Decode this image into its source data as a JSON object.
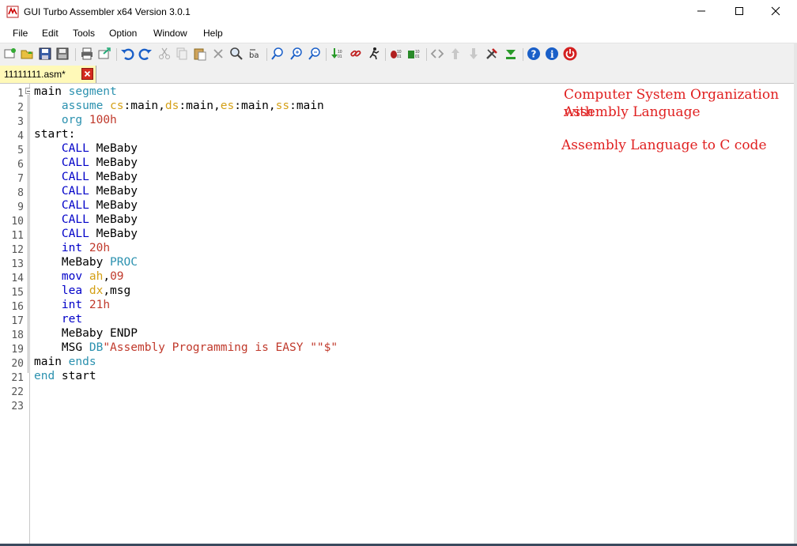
{
  "window": {
    "title": "GUI Turbo Assembler x64 Version 3.0.1",
    "controls": [
      "minimize-icon",
      "maximize-icon",
      "close-icon"
    ]
  },
  "menu": {
    "items": [
      "File",
      "Edit",
      "Tools",
      "Option",
      "Window",
      "Help"
    ]
  },
  "toolbar": {
    "icons": [
      "new-file-icon",
      "open-folder-icon",
      "save-icon",
      "save-all-icon",
      "print-icon",
      "export-icon",
      "undo-icon",
      "redo-icon",
      "cut-icon",
      "copy-icon",
      "paste-icon",
      "delete-icon",
      "find-icon",
      "replace-icon",
      "find-next-icon",
      "zoom-in-icon",
      "zoom-out-icon",
      "assemble-icon",
      "link-icon",
      "run-icon",
      "debug-icon",
      "breakpoint-icon",
      "code-view-icon",
      "move-up-icon",
      "move-down-icon",
      "tools-icon",
      "download-icon",
      "help-icon",
      "info-icon",
      "power-icon"
    ]
  },
  "tab": {
    "label": "11111111.asm*"
  },
  "editor": {
    "line_numbers": [
      "1",
      "2",
      "3",
      "4",
      "5",
      "6",
      "7",
      "8",
      "9",
      "10",
      "11",
      "12",
      "13",
      "14",
      "15",
      "16",
      "17",
      "18",
      "19",
      "20",
      "21",
      "22",
      "23"
    ],
    "lines": [
      [
        {
          "t": "main ",
          "c": "plain"
        },
        {
          "t": "segment",
          "c": "directive"
        }
      ],
      [
        {
          "t": "    ",
          "c": "plain"
        },
        {
          "t": "assume",
          "c": "directive"
        },
        {
          "t": " ",
          "c": "plain"
        },
        {
          "t": "cs",
          "c": "register"
        },
        {
          "t": ":main,",
          "c": "plain"
        },
        {
          "t": "ds",
          "c": "register"
        },
        {
          "t": ":main,",
          "c": "plain"
        },
        {
          "t": "es",
          "c": "register"
        },
        {
          "t": ":main,",
          "c": "plain"
        },
        {
          "t": "ss",
          "c": "register"
        },
        {
          "t": ":main",
          "c": "plain"
        }
      ],
      [
        {
          "t": "    ",
          "c": "plain"
        },
        {
          "t": "org",
          "c": "directive"
        },
        {
          "t": " ",
          "c": "plain"
        },
        {
          "t": "100h",
          "c": "number"
        }
      ],
      [
        {
          "t": "start:",
          "c": "plain"
        }
      ],
      [
        {
          "t": "    ",
          "c": "plain"
        },
        {
          "t": "CALL",
          "c": "instruction"
        },
        {
          "t": " MeBaby",
          "c": "plain"
        }
      ],
      [
        {
          "t": "    ",
          "c": "plain"
        },
        {
          "t": "CALL",
          "c": "instruction"
        },
        {
          "t": " MeBaby",
          "c": "plain"
        }
      ],
      [
        {
          "t": "    ",
          "c": "plain"
        },
        {
          "t": "CALL",
          "c": "instruction"
        },
        {
          "t": " MeBaby",
          "c": "plain"
        }
      ],
      [
        {
          "t": "    ",
          "c": "plain"
        },
        {
          "t": "CALL",
          "c": "instruction"
        },
        {
          "t": " MeBaby",
          "c": "plain"
        }
      ],
      [
        {
          "t": "    ",
          "c": "plain"
        },
        {
          "t": "CALL",
          "c": "instruction"
        },
        {
          "t": " MeBaby",
          "c": "plain"
        }
      ],
      [
        {
          "t": "    ",
          "c": "plain"
        },
        {
          "t": "CALL",
          "c": "instruction"
        },
        {
          "t": " MeBaby",
          "c": "plain"
        }
      ],
      [
        {
          "t": "    ",
          "c": "plain"
        },
        {
          "t": "CALL",
          "c": "instruction"
        },
        {
          "t": " MeBaby",
          "c": "plain"
        }
      ],
      [
        {
          "t": "    ",
          "c": "plain"
        },
        {
          "t": "int",
          "c": "instruction"
        },
        {
          "t": " ",
          "c": "plain"
        },
        {
          "t": "20h",
          "c": "number"
        }
      ],
      [
        {
          "t": "    MeBaby ",
          "c": "plain"
        },
        {
          "t": "PROC",
          "c": "directive"
        }
      ],
      [
        {
          "t": "    ",
          "c": "plain"
        },
        {
          "t": "mov",
          "c": "instruction"
        },
        {
          "t": " ",
          "c": "plain"
        },
        {
          "t": "ah",
          "c": "register"
        },
        {
          "t": ",",
          "c": "plain"
        },
        {
          "t": "09",
          "c": "number"
        }
      ],
      [
        {
          "t": "    ",
          "c": "plain"
        },
        {
          "t": "lea",
          "c": "instruction"
        },
        {
          "t": " ",
          "c": "plain"
        },
        {
          "t": "dx",
          "c": "register"
        },
        {
          "t": ",msg",
          "c": "plain"
        }
      ],
      [
        {
          "t": "    ",
          "c": "plain"
        },
        {
          "t": "int",
          "c": "instruction"
        },
        {
          "t": " ",
          "c": "plain"
        },
        {
          "t": "21h",
          "c": "number"
        }
      ],
      [
        {
          "t": "    ",
          "c": "plain"
        },
        {
          "t": "ret",
          "c": "instruction"
        }
      ],
      [
        {
          "t": "    MeBaby ENDP",
          "c": "plain"
        }
      ],
      [
        {
          "t": "    MSG ",
          "c": "plain"
        },
        {
          "t": "DB",
          "c": "directive"
        },
        {
          "t": "\"Assembly Programming is EASY \"\"$\"",
          "c": "string"
        }
      ],
      [
        {
          "t": "main ",
          "c": "plain"
        },
        {
          "t": "ends",
          "c": "directive"
        }
      ],
      [
        {
          "t": "end",
          "c": "directive"
        },
        {
          "t": " start",
          "c": "plain"
        }
      ],
      [],
      []
    ]
  },
  "syntax_colors": {
    "plain": "#000000",
    "directive": "#2b91af",
    "register": "#d4a017",
    "number": "#c0392b",
    "instruction": "#0000c8",
    "string": "#c0392b"
  },
  "overlay": {
    "title_line1": "Computer System Organization with",
    "title_line2": "Assembly Language",
    "subtitle": "Assembly Language to C code",
    "color": "#e02020"
  }
}
